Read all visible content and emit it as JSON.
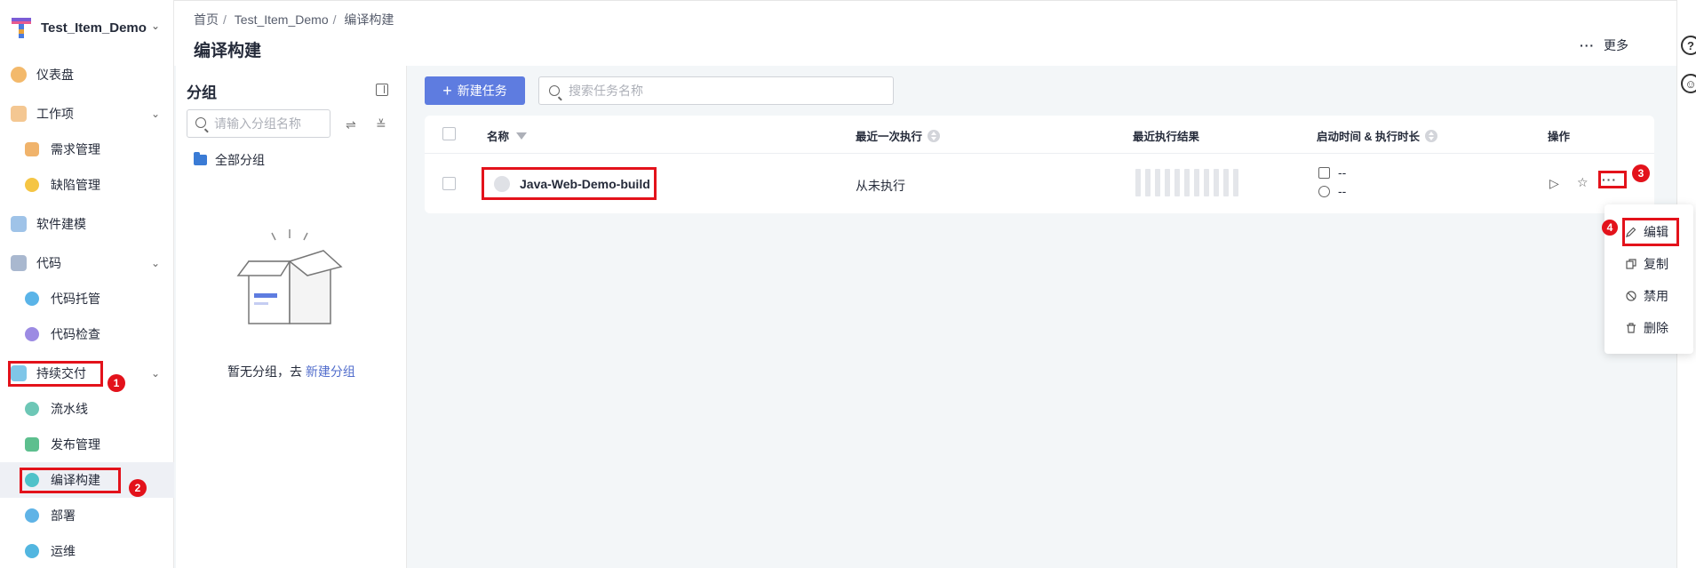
{
  "project": {
    "name": "Test_Item_Demo"
  },
  "sidebar": {
    "items": [
      {
        "label": "仪表盘"
      },
      {
        "label": "工作项"
      },
      {
        "label": "需求管理"
      },
      {
        "label": "缺陷管理"
      },
      {
        "label": "软件建模"
      },
      {
        "label": "代码"
      },
      {
        "label": "代码托管"
      },
      {
        "label": "代码检查"
      },
      {
        "label": "持续交付"
      },
      {
        "label": "流水线"
      },
      {
        "label": "发布管理"
      },
      {
        "label": "编译构建"
      },
      {
        "label": "部署"
      },
      {
        "label": "运维"
      }
    ]
  },
  "header": {
    "breadcrumb": [
      "首页",
      "Test_Item_Demo",
      "编译构建"
    ],
    "title": "编译构建",
    "more_label": "更多"
  },
  "group_panel": {
    "title": "分组",
    "search_placeholder": "请输入分组名称",
    "all_groups": "全部分组",
    "empty_text": "暂无分组，去",
    "empty_link": "新建分组"
  },
  "toolbar": {
    "new_task_label": "新建任务",
    "search_placeholder": "搜索任务名称"
  },
  "table": {
    "headers": {
      "name": "名称",
      "last_exec": "最近一次执行",
      "last_result": "最近执行结果",
      "start_duration": "启动时间 & 执行时长",
      "actions": "操作"
    },
    "rows": [
      {
        "name": "Java-Web-Demo-build",
        "last_exec": "从未执行",
        "start_time": "--",
        "duration": "--"
      }
    ]
  },
  "more_menu": {
    "items": [
      {
        "label": "编辑",
        "icon": "pencil-icon"
      },
      {
        "label": "复制",
        "icon": "copy-icon"
      },
      {
        "label": "禁用",
        "icon": "disable-icon"
      },
      {
        "label": "删除",
        "icon": "trash-icon"
      }
    ]
  },
  "annotations": [
    "1",
    "2",
    "3",
    "4"
  ],
  "colors": {
    "primary": "#5e7ce0",
    "highlight": "#e3121b",
    "link": "#526ecc"
  }
}
